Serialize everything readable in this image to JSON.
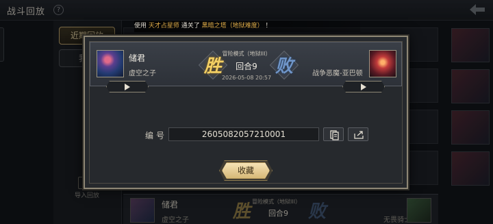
{
  "page": {
    "title": "战斗回放",
    "help_symbol": "?"
  },
  "tabs": [
    {
      "label": "近期回放"
    },
    {
      "label": "我的"
    }
  ],
  "import_label": "导入回放",
  "notice": {
    "prefix": "使用 ",
    "deck": "天才占星师",
    "middle": " 通关了 ",
    "stage": "黑暗之塔（地狱难度）",
    "suffix": " ！"
  },
  "bottom_row": {
    "name": "储君",
    "sub": "虚空之子",
    "mode": "冒险模式（地狱III）",
    "round": "回合9",
    "win": "胜",
    "lose": "败",
    "right_text": "无畏骑士"
  },
  "modal": {
    "player1": {
      "name": "储君",
      "deck": "虚空之子"
    },
    "player2": {
      "deck": "战争恶魔-亚巴顿"
    },
    "mode": "冒险模式（地狱III）",
    "round": "回合9",
    "datetime": "2026-05-08 20:57",
    "win": "胜",
    "lose": "败",
    "id_label": "编号",
    "id_value": "2605082057210001",
    "favorite_label": "收藏"
  },
  "icons": {
    "help": "help-icon",
    "back": "back-arrow-icon",
    "play": "play-icon",
    "copy": "copy-icon",
    "share": "share-icon",
    "import": "import-icon"
  },
  "colors": {
    "accent_gold": "#d7b978",
    "win": "#f3cf63",
    "lose": "#6f95c8",
    "notice_highlight": "#e7b24b"
  }
}
